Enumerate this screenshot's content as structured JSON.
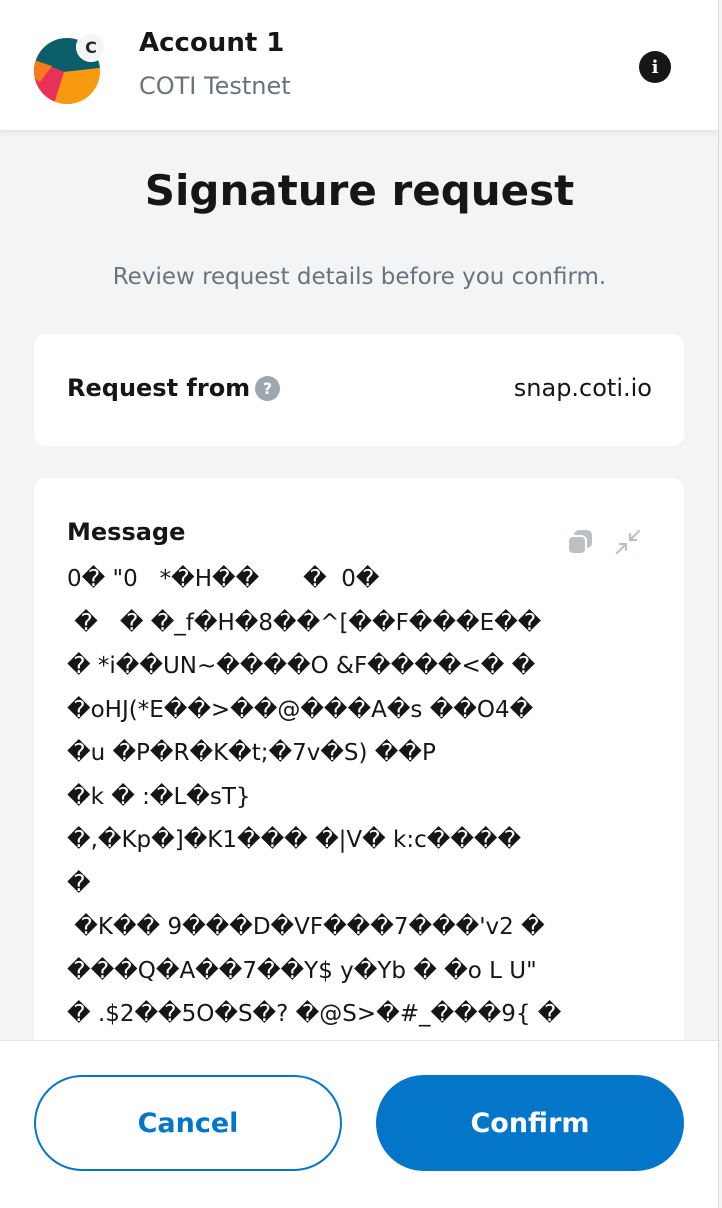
{
  "header": {
    "account_name": "Account 1",
    "network_name": "COTI Testnet",
    "network_badge": "C",
    "info_icon": "info-icon"
  },
  "page": {
    "title": "Signature request",
    "subtitle": "Review request details before you confirm."
  },
  "request": {
    "label": "Request from",
    "help_icon": "question-icon",
    "origin": "snap.coti.io"
  },
  "message": {
    "label": "Message",
    "lines": [
      "0� \"0   *�H��      �  0�",
      " �   � �_f�H�8��^[��F���E��",
      "� *i��UN~����O &F����<� �",
      "�oHJ(*E��>��@���A�s ��O4�",
      "�u �P�R�K�t;�7v�S) ��P",
      "�k � :�L�sT}",
      "�,�Kp�]�K1��� �|V� k:c����",
      "�",
      " �K�� 9���D�VF���7���'v2 �",
      "���Q�A��7��Y$ y�Yb � �o L U\"",
      "� .$2��5O�S�? �@S>�#_���9{ �"
    ]
  },
  "actions": {
    "cancel_label": "Cancel",
    "confirm_label": "Confirm"
  },
  "colors": {
    "primary": "#0376c9",
    "background": "#f2f4f6",
    "text": "#141618",
    "muted": "#6a737d"
  }
}
